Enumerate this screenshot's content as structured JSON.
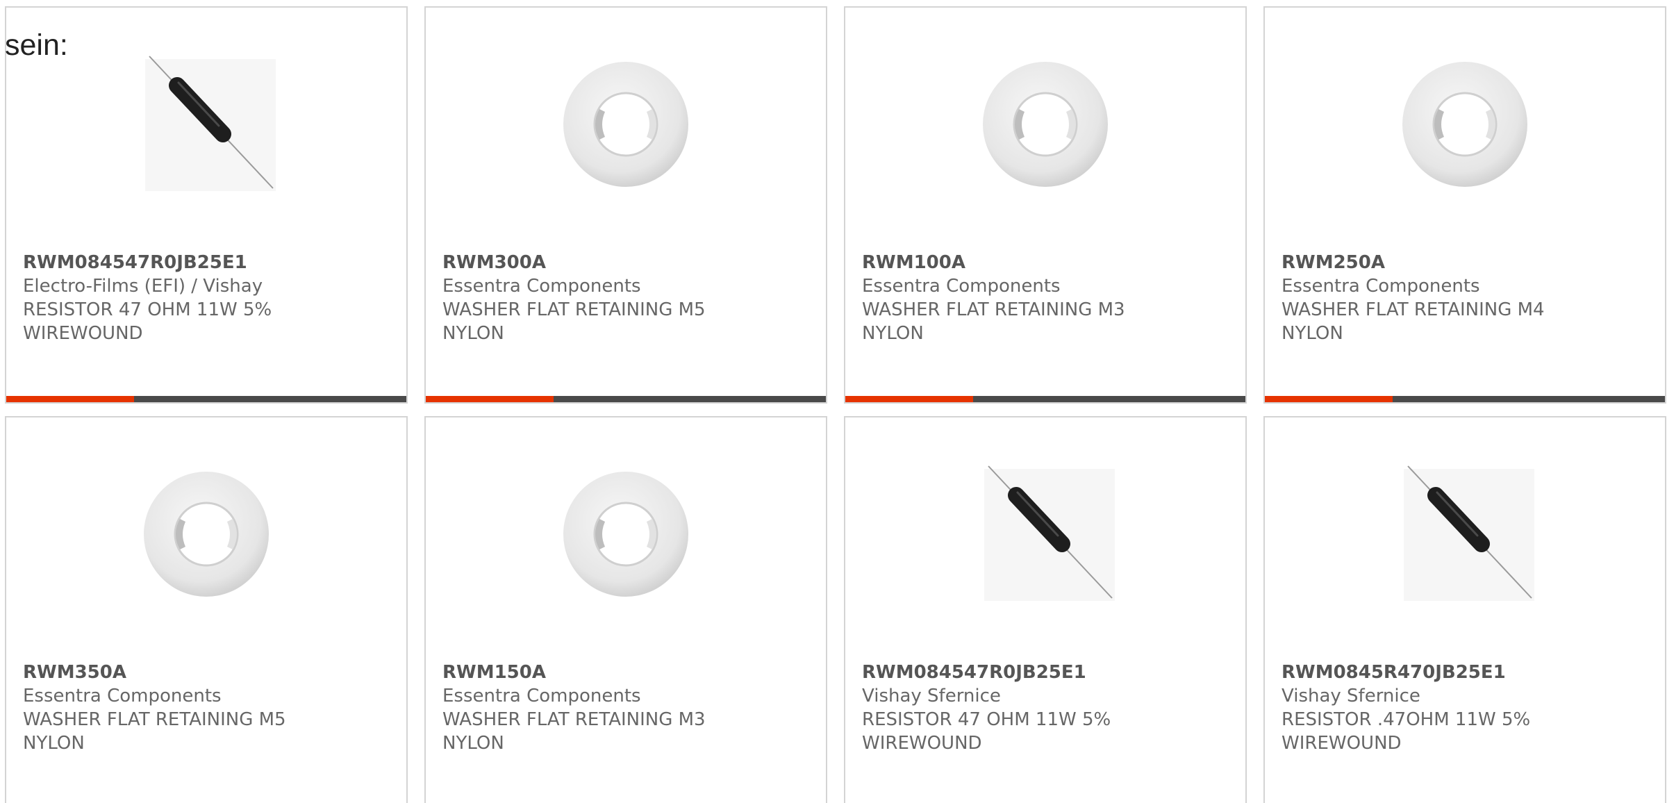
{
  "intro_text": "sein:",
  "colors": {
    "accent": "#e63300",
    "bar": "#4a4a4a",
    "border": "#d4d4d4",
    "text": "#666666"
  },
  "products": [
    {
      "part_number": "RWM084547R0JB25E1",
      "manufacturer": "Electro-Films (EFI) / Vishay",
      "description_line1": "RESISTOR 47 OHM 11W 5%",
      "description_line2": "WIREWOUND",
      "image": "resistor-image",
      "progress": 0.32
    },
    {
      "part_number": "RWM300A",
      "manufacturer": "Essentra Components",
      "description_line1": "WASHER FLAT RETAINING M5",
      "description_line2": "NYLON",
      "image": "washer-image",
      "progress": 0.32
    },
    {
      "part_number": "RWM100A",
      "manufacturer": "Essentra Components",
      "description_line1": "WASHER FLAT RETAINING M3",
      "description_line2": "NYLON",
      "image": "washer-image",
      "progress": 0.32
    },
    {
      "part_number": "RWM250A",
      "manufacturer": "Essentra Components",
      "description_line1": "WASHER FLAT RETAINING M4",
      "description_line2": "NYLON",
      "image": "washer-image",
      "progress": 0.32
    },
    {
      "part_number": "RWM350A",
      "manufacturer": "Essentra Components",
      "description_line1": "WASHER FLAT RETAINING M5",
      "description_line2": "NYLON",
      "image": "washer-image",
      "progress": 0.32
    },
    {
      "part_number": "RWM150A",
      "manufacturer": "Essentra Components",
      "description_line1": "WASHER FLAT RETAINING M3",
      "description_line2": "NYLON",
      "image": "washer-image",
      "progress": 0.32
    },
    {
      "part_number": "RWM084547R0JB25E1",
      "manufacturer": "Vishay Sfernice",
      "description_line1": "RESISTOR 47 OHM 11W 5%",
      "description_line2": "WIREWOUND",
      "image": "resistor-image",
      "progress": 0.32
    },
    {
      "part_number": "RWM0845R470JB25E1",
      "manufacturer": "Vishay Sfernice",
      "description_line1": "RESISTOR .47OHM 11W 5%",
      "description_line2": "WIREWOUND",
      "image": "resistor-image",
      "progress": 0.32
    }
  ]
}
